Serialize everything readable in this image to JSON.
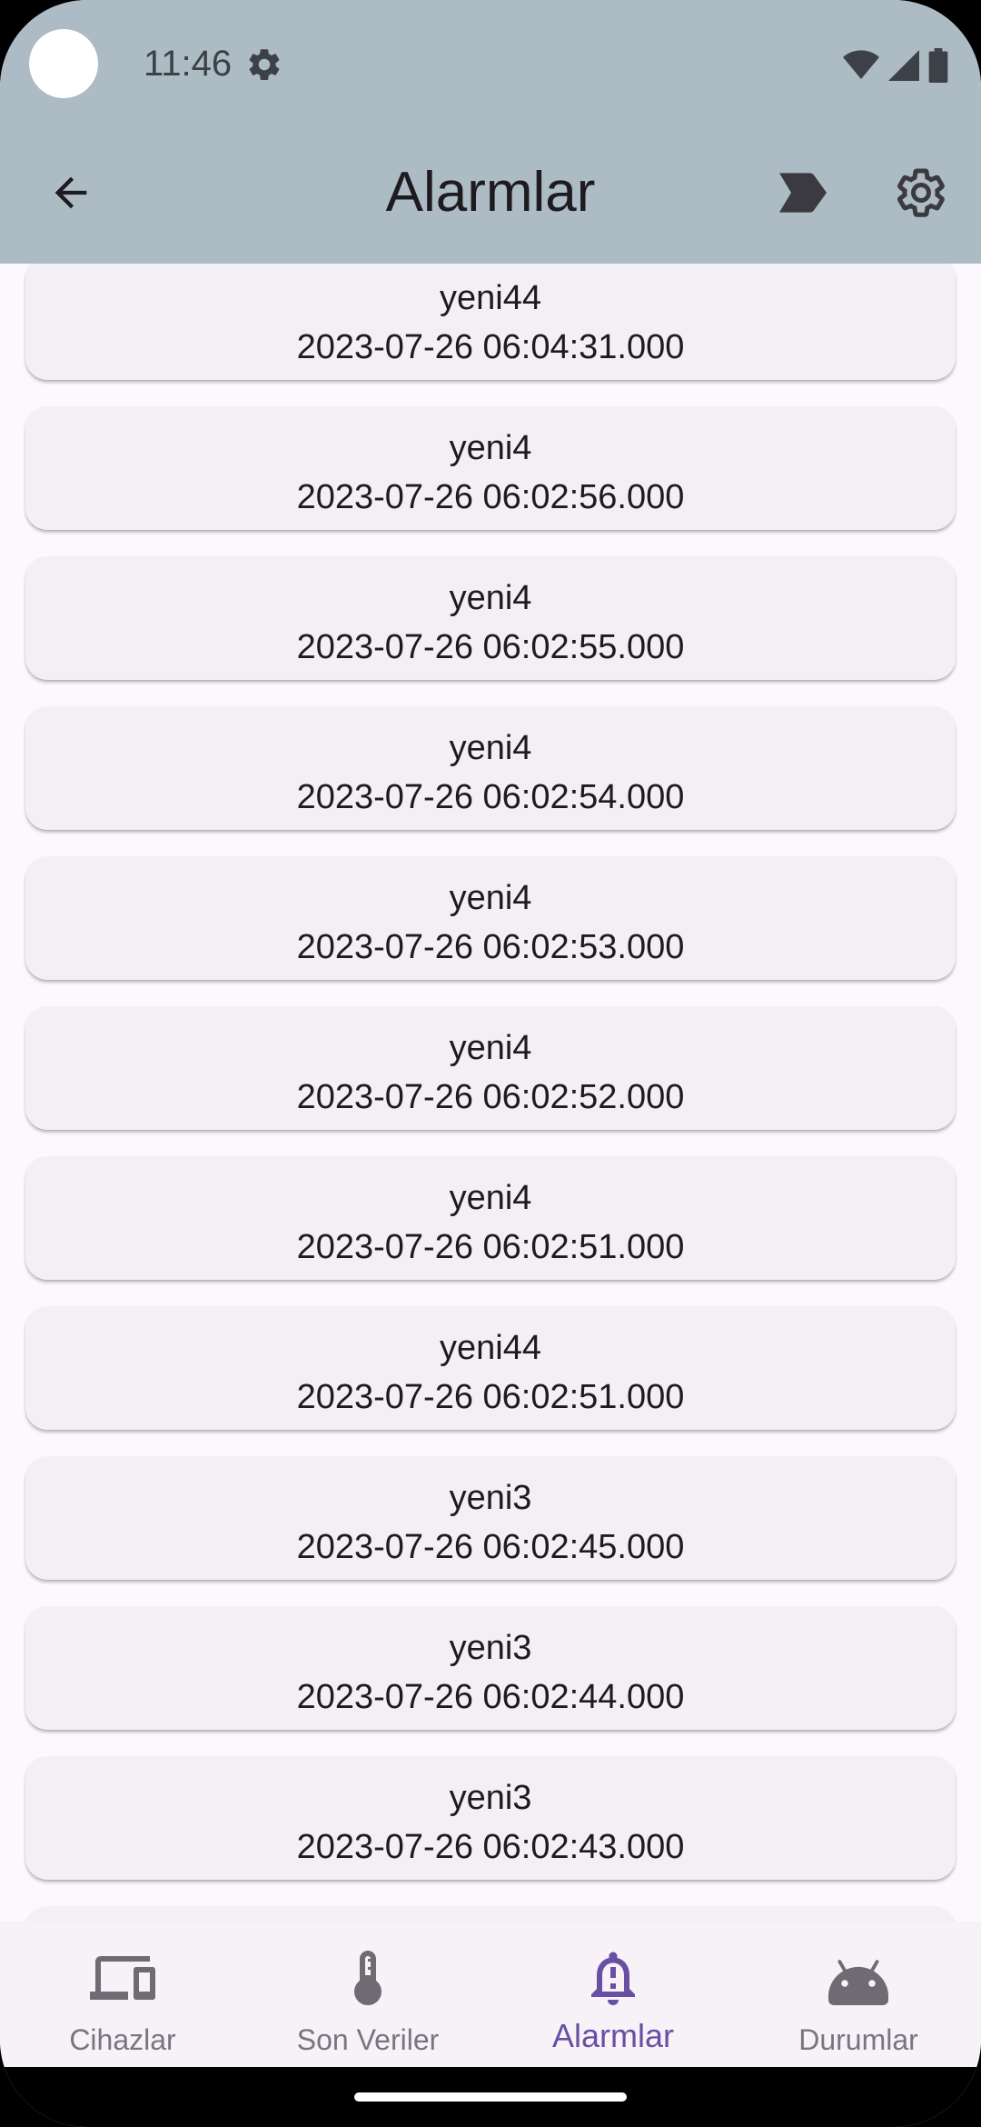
{
  "status_bar": {
    "time": "11:46"
  },
  "app_bar": {
    "title": "Alarmlar"
  },
  "alarms": [
    {
      "name": "yeni44",
      "time": "2023-07-26 06:04:31.000"
    },
    {
      "name": "yeni4",
      "time": "2023-07-26 06:02:56.000"
    },
    {
      "name": "yeni4",
      "time": "2023-07-26 06:02:55.000"
    },
    {
      "name": "yeni4",
      "time": "2023-07-26 06:02:54.000"
    },
    {
      "name": "yeni4",
      "time": "2023-07-26 06:02:53.000"
    },
    {
      "name": "yeni4",
      "time": "2023-07-26 06:02:52.000"
    },
    {
      "name": "yeni4",
      "time": "2023-07-26 06:02:51.000"
    },
    {
      "name": "yeni44",
      "time": "2023-07-26 06:02:51.000"
    },
    {
      "name": "yeni3",
      "time": "2023-07-26 06:02:45.000"
    },
    {
      "name": "yeni3",
      "time": "2023-07-26 06:02:44.000"
    },
    {
      "name": "yeni3",
      "time": "2023-07-26 06:02:43.000"
    }
  ],
  "bottom_nav": {
    "items": [
      {
        "label": "Cihazlar",
        "icon": "devices-icon",
        "active": false
      },
      {
        "label": "Son Veriler",
        "icon": "thermostat-icon",
        "active": false
      },
      {
        "label": "Alarmlar",
        "icon": "notification-important-icon",
        "active": true
      },
      {
        "label": "Durumlar",
        "icon": "android-icon",
        "active": false
      }
    ]
  },
  "colors": {
    "app_bar": "#adbcc4",
    "background": "#fdf8fd",
    "card": "#f3eff4",
    "nav_active": "#6750a4",
    "nav_inactive": "#79757f",
    "icon_dark": "#3c3a41"
  }
}
